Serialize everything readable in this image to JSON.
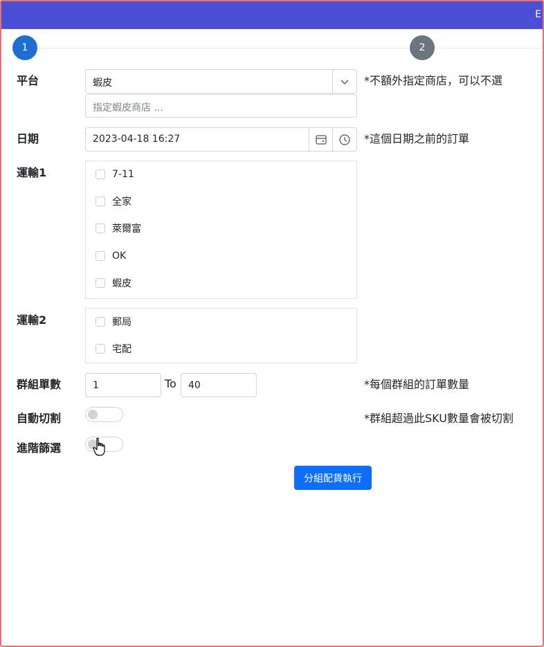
{
  "topbar": {
    "corner_text": "E"
  },
  "steps": [
    {
      "label": "1"
    },
    {
      "label": "2"
    }
  ],
  "form": {
    "platform": {
      "label": "平台",
      "selected": "蝦皮",
      "store_placeholder": "指定蝦皮商店 ...",
      "note": "*不額外指定商店，可以不選"
    },
    "date": {
      "label": "日期",
      "value": "2023-04-18 16:27",
      "note": "*這個日期之前的訂單"
    },
    "shipping1": {
      "label": "運輸1",
      "options": [
        "7-11",
        "全家",
        "萊爾富",
        "OK",
        "蝦皮"
      ]
    },
    "shipping2": {
      "label": "運輸2",
      "options": [
        "郵局",
        "宅配"
      ]
    },
    "group_count": {
      "label": "群組單數",
      "from": "1",
      "to_label": "To",
      "to": "40",
      "note": "*每個群組的訂單數量"
    },
    "auto_split": {
      "label": "自動切割",
      "note": "*群組超過此SKU數量會被切割"
    },
    "advanced_filter": {
      "label": "進階篩選"
    },
    "submit_label": "分組配貨執行"
  }
}
